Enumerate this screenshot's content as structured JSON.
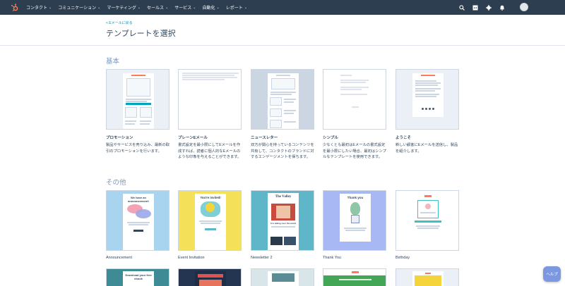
{
  "nav": {
    "items": [
      "コンタクト",
      "コミュニケーション",
      "マーケティング",
      "セールス",
      "サービス",
      "自動化",
      "レポート"
    ]
  },
  "header": {
    "back_link": "< Eメールに戻る",
    "title": "テンプレートを選択"
  },
  "sections": {
    "basic": "基本",
    "other": "その他"
  },
  "basic_templates": [
    {
      "name": "プロモーション",
      "desc": "製品やサービスを売り込み、最新の取引のプロモーションを行います。"
    },
    {
      "name": "プレーンEメール",
      "desc": "書式設定を最小限にしてEメールを作成すれば、読者に個人的なEメールのような印象を与えることができます。"
    },
    {
      "name": "ニュースレター",
      "desc": "双方が関心を持っているコンテンツを共有して、コンタクトのブランドに対するエンゲージメントを保ちます。"
    },
    {
      "name": "シンプル",
      "desc": "少なくとも最初はEメールの書式設定を最小限にしたい場合、最初はシンプルなテンプレートを使用できます。"
    },
    {
      "name": "ようこそ",
      "desc": "新しい顧客にEメールを送信し、製品を紹介します。"
    }
  ],
  "other_templates": [
    {
      "name": "Announcement",
      "preview_text": "We have an announcement!"
    },
    {
      "name": "Event Invitation",
      "preview_text": "You're invited!"
    },
    {
      "name": "Newsletter 2",
      "preview_text": "The Valley",
      "preview_sub": "It is taking over the world"
    },
    {
      "name": "Thank You",
      "preview_text": "Thank you"
    },
    {
      "name": "Birthday",
      "preview_text": ""
    }
  ],
  "third_row": [
    {
      "preview_text": "Download your free ebook"
    },
    {
      "preview_text": ""
    },
    {
      "preview_text": ""
    },
    {
      "preview_text": ""
    },
    {
      "preview_text": ""
    }
  ],
  "help": "ヘルプ",
  "colors": {
    "nav_bg": "#2d3e50",
    "accent": "#ff7a59",
    "link": "#0091ae",
    "announcement_bg": "#a8d4f0",
    "invitation_bg": "#f5e05a",
    "newsletter2_bg": "#5fb6c8",
    "thankyou_bg": "#a7b8f5"
  }
}
